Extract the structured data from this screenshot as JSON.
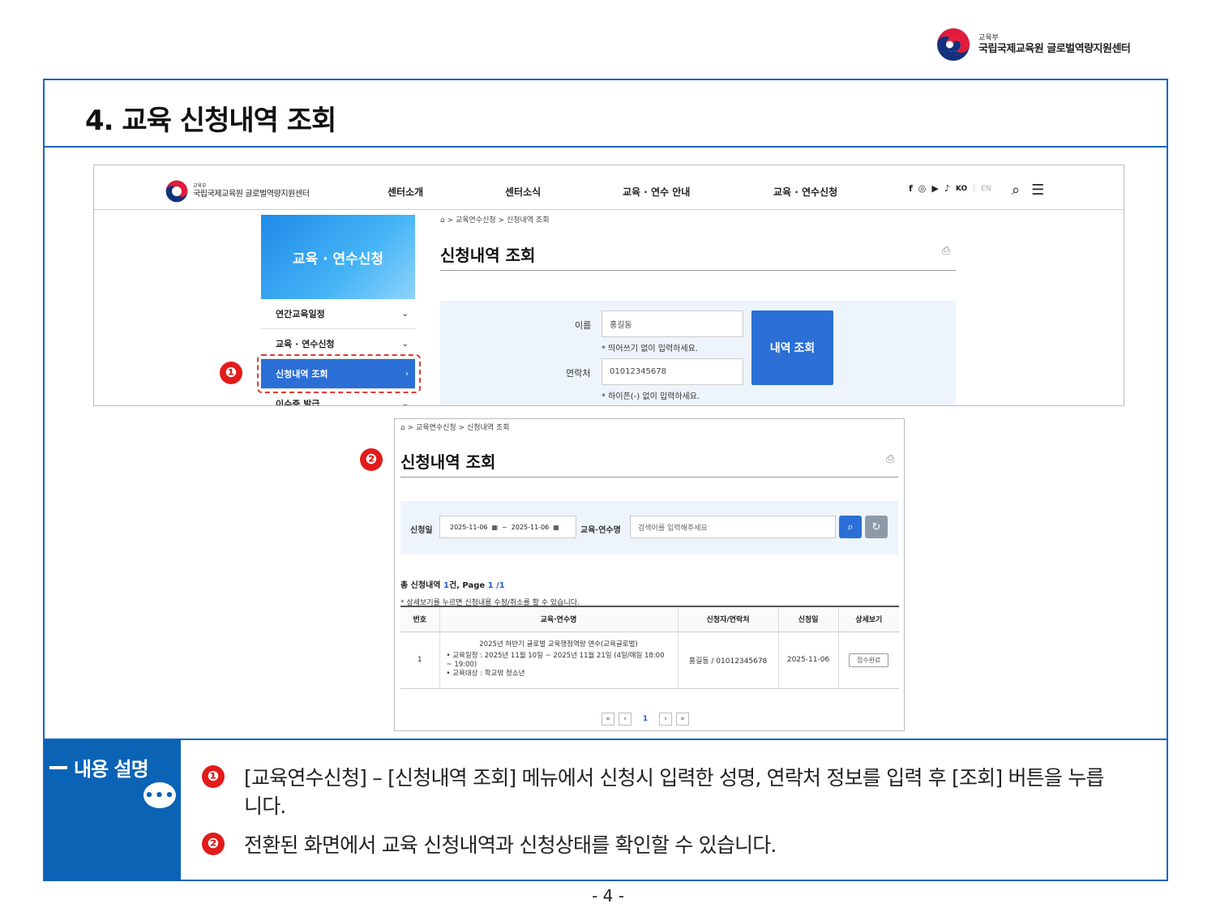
{
  "org": {
    "small": "교육부",
    "name": "국립국제교육원 글로벌역량지원센터"
  },
  "doc": {
    "title": "4. 교육 신청내역 조회",
    "page_number": "- 4 -"
  },
  "site": {
    "logo_small": "교육부",
    "logo_name": "국립국제교육원 글로벌역량지원센터",
    "nav": [
      "센터소개",
      "센터소식",
      "교육 · 연수 안내",
      "교육 · 연수신청"
    ],
    "lang_active": "KO",
    "lang_inactive": "EN",
    "icons": [
      "facebook-icon",
      "instagram-icon",
      "youtube-icon",
      "bell-icon",
      "search-icon",
      "menu-icon"
    ]
  },
  "sidebar": {
    "banner": "교육 · 연수신청",
    "items": [
      {
        "label": "연간교육일정",
        "active": false
      },
      {
        "label": "교육 · 연수신청",
        "active": false
      },
      {
        "label": "신청내역 조회",
        "active": true
      },
      {
        "label": "이수증 발급",
        "active": false
      }
    ]
  },
  "lookup": {
    "breadcrumb": "> 교육연수신청   > 신청내역 조회",
    "heading": "신청내역 조회",
    "name_label": "이름",
    "name_value": "홍길동",
    "name_hint": "* 띄어쓰기 없이 입력하세요.",
    "phone_label": "연락처",
    "phone_value": "01012345678",
    "phone_hint": "* 하이픈(-) 없이 입력하세요.",
    "submit_label": "내역 조회"
  },
  "markers": [
    "❶",
    "❷"
  ],
  "results": {
    "breadcrumb": "> 교육연수신청   > 신청내역 조회",
    "heading": "신청내역 조회",
    "date_label": "신청일",
    "date_from": "2025-11-06",
    "date_to": "2025-11-06",
    "date_sep": "~",
    "course_label": "교육·연수명",
    "course_placeholder": "검색어를 입력해주세요",
    "total_prefix": "총 신청내역 ",
    "total_count": "1",
    "total_mid": "건, Page ",
    "total_page": "1 /1",
    "note": "* 상세보기를 누르면 신청내용 수정/취소를 할 수 있습니다.",
    "columns": [
      "번호",
      "교육·연수명",
      "신청자/연락처",
      "신청일",
      "상세보기"
    ],
    "rows": [
      {
        "no": "1",
        "course_title": "2025년 하반기 글로벌 교육행정역량 연수(교육글로벌)",
        "course_period": "• 교육일정 : 2025년 11월 10일 ~ 2025년 11월 21일 (4일/매일 18:00 ~ 19:00)",
        "course_target": "• 교육대상 : 학교밖 청소년",
        "applicant": "홍길동 / 01012345678",
        "date": "2025-11-06",
        "status": "접수완료"
      }
    ],
    "pager": {
      "first": "«",
      "prev": "‹",
      "current": "1",
      "next": "›",
      "last": "»"
    }
  },
  "explain": {
    "label": "내용 설명",
    "items": [
      "[교육연수신청] – [신청내역 조회] 메뉴에서 신청시 입력한 성명, 연락처 정보를 입력 후 [조회] 버튼을 누릅니다.",
      "전환된 화면에서 교육 신청내역과 신청상태를 확인할 수 있습니다."
    ]
  },
  "colors": {
    "frame": "#1565c0",
    "accent": "#2b6fd6",
    "marker": "#e21b1b",
    "side": "#0b63b6"
  }
}
